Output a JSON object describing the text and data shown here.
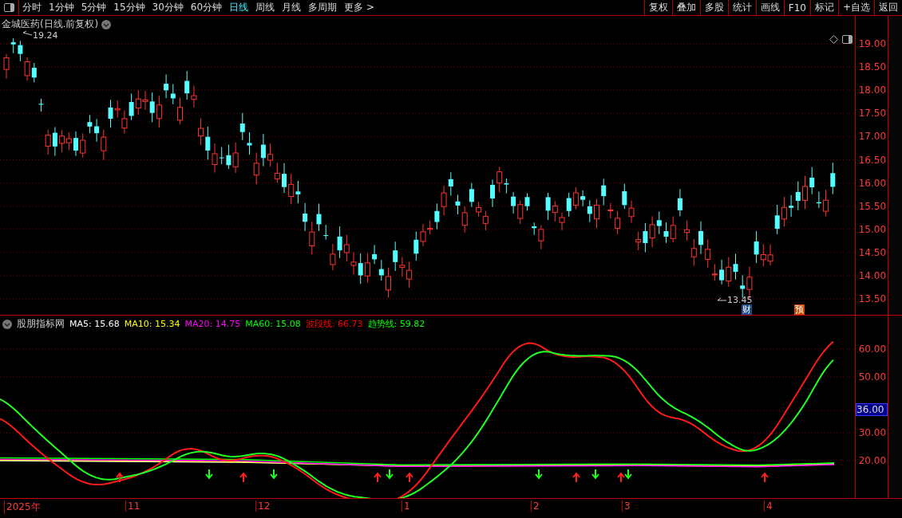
{
  "toolbar": {
    "periods": [
      {
        "label": "分时",
        "selected": false
      },
      {
        "label": "1分钟",
        "selected": false
      },
      {
        "label": "5分钟",
        "selected": false
      },
      {
        "label": "15分钟",
        "selected": false
      },
      {
        "label": "30分钟",
        "selected": false
      },
      {
        "label": "60分钟",
        "selected": false
      },
      {
        "label": "日线",
        "selected": true
      },
      {
        "label": "周线",
        "selected": false
      },
      {
        "label": "月线",
        "selected": false
      },
      {
        "label": "多周期",
        "selected": false
      },
      {
        "label": "更多 >",
        "selected": false
      }
    ],
    "actions": [
      "复权",
      "叠加",
      "多股",
      "统计",
      "画线",
      "F10",
      "标记",
      "+自选",
      "返回"
    ]
  },
  "price_panel": {
    "title": "金城医药(日线.前复权)",
    "high_label": "19.24",
    "low_label": "13.45",
    "badges": [
      {
        "text": "财",
        "kind": "finance"
      },
      {
        "text": "预",
        "kind": "forecast"
      }
    ],
    "axis_ticks": [
      "19.00",
      "18.50",
      "18.00",
      "17.50",
      "17.00",
      "16.50",
      "16.00",
      "15.50",
      "15.00",
      "14.50",
      "14.00",
      "13.50"
    ]
  },
  "indicator_panel": {
    "title": "股朋指标网",
    "legend": [
      {
        "text": "MA5: 15.68",
        "color": "#ffffff"
      },
      {
        "text": "MA10: 15.34",
        "color": "#ffff00"
      },
      {
        "text": "MA20: 14.75",
        "color": "#ff00ff"
      },
      {
        "text": "MA60: 15.08",
        "color": "#00ff00"
      },
      {
        "text": "波段线: 66.73",
        "color": "#ff0000"
      },
      {
        "text": "趋势线: 59.82",
        "color": "#00ff00"
      }
    ],
    "axis_ticks": [
      "60.00",
      "50.00",
      "30.00",
      "20.00"
    ],
    "current_value": "36.00"
  },
  "x_axis": [
    "2025年",
    "11",
    "12",
    "1",
    "2",
    "3",
    "4"
  ]
}
